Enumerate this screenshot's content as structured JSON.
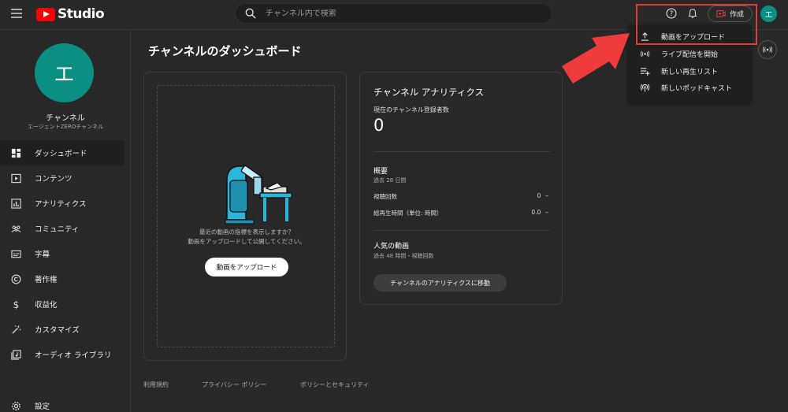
{
  "header": {
    "logo_text": "Studio",
    "search_placeholder": "チャンネル内で検索",
    "create_label": "作成",
    "avatar_initial": "エ"
  },
  "sidebar": {
    "avatar_initial": "エ",
    "channel_title": "チャンネル",
    "channel_name": "エージェントZEROチャンネル",
    "items": [
      {
        "label": "ダッシュボード",
        "icon": "dashboard-icon"
      },
      {
        "label": "コンテンツ",
        "icon": "content-icon"
      },
      {
        "label": "アナリティクス",
        "icon": "analytics-icon"
      },
      {
        "label": "コミュニティ",
        "icon": "community-icon"
      },
      {
        "label": "字幕",
        "icon": "subtitles-icon"
      },
      {
        "label": "著作権",
        "icon": "copyright-icon"
      },
      {
        "label": "収益化",
        "icon": "dollar-icon"
      },
      {
        "label": "カスタマイズ",
        "icon": "magic-wand-icon"
      },
      {
        "label": "オーディオ ライブラリ",
        "icon": "audio-library-icon"
      }
    ],
    "settings_label": "設定"
  },
  "main": {
    "page_title": "チャンネルのダッシュボード",
    "upload_card": {
      "text_line1": "最近の動画の指標を表示しますか？",
      "text_line2": "動画をアップロードして公開してください。",
      "button": "動画をアップロード"
    },
    "analytics": {
      "title": "チャンネル アナリティクス",
      "subs_label": "現在のチャンネル登録者数",
      "subs_value": "0",
      "summary_title": "概要",
      "summary_period": "過去 28 日間",
      "rows": [
        {
          "label": "視聴回数",
          "value": "0",
          "trend": "–"
        },
        {
          "label": "総再生時間（単位: 時間）",
          "value": "0.0",
          "trend": "–"
        }
      ],
      "popular_title": "人気の動画",
      "popular_sub": "過去 48 時間・視聴回数",
      "button": "チャンネルのアナリティクスに移動"
    },
    "footer": [
      "利用規約",
      "プライバシー ポリシー",
      "ポリシーとセキュリティ"
    ]
  },
  "dropdown": {
    "items": [
      {
        "label": "動画をアップロード",
        "icon": "upload-icon"
      },
      {
        "label": "ライブ配信を開始",
        "icon": "live-icon"
      },
      {
        "label": "新しい再生リスト",
        "icon": "playlist-add-icon"
      },
      {
        "label": "新しいポッドキャスト",
        "icon": "podcast-icon"
      }
    ]
  },
  "colors": {
    "background": "#282828",
    "accent": "#0b8f83",
    "brand_red": "#ff0000",
    "annotation_red": "#e53935"
  }
}
